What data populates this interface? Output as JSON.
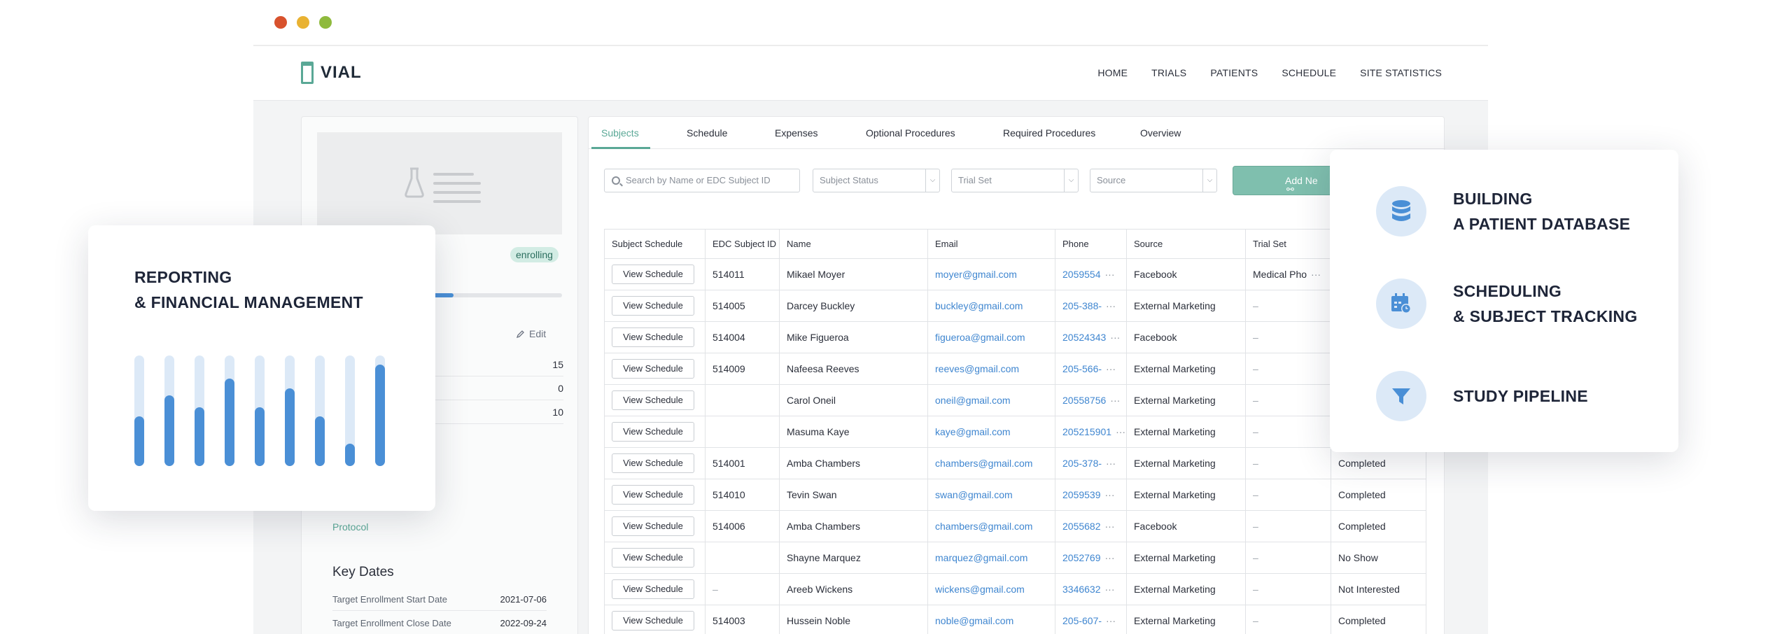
{
  "window": {
    "dots": [
      "close",
      "minimize",
      "maximize"
    ]
  },
  "app": {
    "logo": "VIAL",
    "nav": [
      "HOME",
      "TRIALS",
      "PATIENTS",
      "SCHEDULE",
      "SITE STATISTICS"
    ]
  },
  "left_panel": {
    "status_badge": "enrolling",
    "enrollment_progress": 0.3,
    "edit_label": "Edit",
    "stats": [
      "15",
      "0",
      "10"
    ],
    "protocol_link": "Protocol",
    "key_dates_title": "Key Dates",
    "key_dates": [
      {
        "label": "Target Enrollment Start Date",
        "value": "2021-07-06"
      },
      {
        "label": "Target Enrollment Close Date",
        "value": "2022-09-24"
      }
    ]
  },
  "main": {
    "tabs": [
      "Subjects",
      "Schedule",
      "Expenses",
      "Optional Procedures",
      "Required Procedures",
      "Overview"
    ],
    "active_tab": "Subjects",
    "search_placeholder": "Search by Name or EDC Subject ID",
    "filters": [
      "Subject Status",
      "Trial Set",
      "Source"
    ],
    "add_button": "Add Ne",
    "columns": [
      "Subject Schedule",
      "EDC Subject ID",
      "Name",
      "Email",
      "Phone",
      "Source",
      "Trial Set",
      ""
    ],
    "view_label": "View Schedule",
    "rows": [
      {
        "id": "514011",
        "name": "Mikael Moyer",
        "email": "moyer@gmail.com",
        "phone": "2059554",
        "source": "Facebook",
        "trial_set": "Medical Pho",
        "status": ""
      },
      {
        "id": "514005",
        "name": "Darcey Buckley",
        "email": "buckley@gmail.com",
        "phone": "205-388-",
        "source": "External Marketing",
        "trial_set": "–",
        "status": ""
      },
      {
        "id": "514004",
        "name": "Mike Figueroa",
        "email": "figueroa@gmail.com",
        "phone": "20524343",
        "source": "Facebook",
        "trial_set": "–",
        "status": ""
      },
      {
        "id": "514009",
        "name": "Nafeesa Reeves",
        "email": "reeves@gmail.com",
        "phone": "205-566-",
        "source": "External Marketing",
        "trial_set": "–",
        "status": ""
      },
      {
        "id": "",
        "name": "Carol Oneil",
        "email": "oneil@gmail.com",
        "phone": "20558756",
        "source": "External Marketing",
        "trial_set": "–",
        "status": ""
      },
      {
        "id": "",
        "name": "Masuma Kaye",
        "email": "kaye@gmail.com",
        "phone": "205215901",
        "source": "External Marketing",
        "trial_set": "–",
        "status": ""
      },
      {
        "id": "514001",
        "name": "Amba Chambers",
        "email": "chambers@gmail.com",
        "phone": "205-378-",
        "source": "External Marketing",
        "trial_set": "–",
        "status": "Completed"
      },
      {
        "id": "514010",
        "name": "Tevin Swan",
        "email": "swan@gmail.com",
        "phone": "2059539",
        "source": "External Marketing",
        "trial_set": "–",
        "status": "Completed"
      },
      {
        "id": "514006",
        "name": "Amba Chambers",
        "email": "chambers@gmail.com",
        "phone": "2055682",
        "source": "Facebook",
        "trial_set": "–",
        "status": "Completed"
      },
      {
        "id": "",
        "name": "Shayne Marquez",
        "email": "marquez@gmail.com",
        "phone": "2052769",
        "source": "External Marketing",
        "trial_set": "–",
        "status": "No Show"
      },
      {
        "id": "–",
        "name": "Areeb Wickens",
        "email": "wickens@gmail.com",
        "phone": "3346632",
        "source": "External Marketing",
        "trial_set": "–",
        "status": "Not Interested"
      },
      {
        "id": "514003",
        "name": "Hussein Noble",
        "email": "noble@gmail.com",
        "phone": "205-607-",
        "source": "External Marketing",
        "trial_set": "–",
        "status": "Completed"
      }
    ]
  },
  "card_left": {
    "title_line1": "REPORTING",
    "title_line2": "& FINANCIAL MANAGEMENT",
    "bar_levels": [
      0.45,
      0.64,
      0.53,
      0.79,
      0.53,
      0.7,
      0.45,
      0.2,
      0.92
    ]
  },
  "card_right": {
    "features": [
      {
        "icon": "database-icon",
        "line1": "BUILDING",
        "line2": "A PATIENT DATABASE"
      },
      {
        "icon": "calendar-clock-icon",
        "line1": "SCHEDULING",
        "line2": "& SUBJECT TRACKING"
      },
      {
        "icon": "funnel-icon",
        "line1": "STUDY PIPELINE",
        "line2": ""
      }
    ]
  },
  "colors": {
    "accent": "#5aa896",
    "link": "#3f86d0",
    "bar": "#4a8fd6",
    "bar_track": "#dce9f7"
  }
}
